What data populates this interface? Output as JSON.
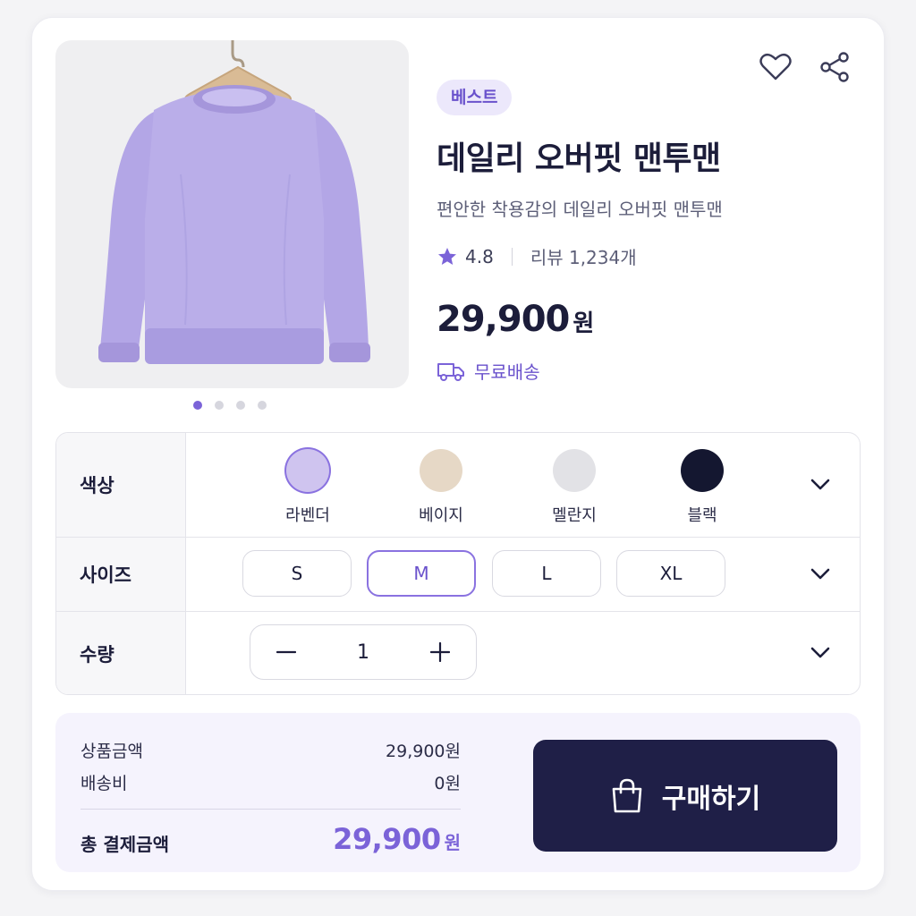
{
  "product": {
    "badge": "베스트",
    "title": "데일리 오버핏 맨투맨",
    "subtitle": "편안한 착용감의 데일리 오버핏 맨투맨",
    "rating": "4.8",
    "reviews": "리뷰 1,234개",
    "price": "29,900",
    "price_unit": "원",
    "shipping": "무료배송",
    "image_icon": "lavender-sweatshirt-on-hanger",
    "image_pages": 4,
    "image_current_page": 1
  },
  "actions": {
    "wishlist_icon": "heart-icon",
    "share_icon": "share-icon"
  },
  "options": {
    "color": {
      "label": "색상",
      "items": [
        {
          "name": "라벤더",
          "hex": "#cfc4ef",
          "selected": true
        },
        {
          "name": "베이지",
          "hex": "#e6d8c6",
          "selected": false
        },
        {
          "name": "멜란지",
          "hex": "#e2e2e6",
          "selected": false
        },
        {
          "name": "블랙",
          "hex": "#141730",
          "selected": false
        }
      ]
    },
    "size": {
      "label": "사이즈",
      "items": [
        {
          "name": "S",
          "selected": false
        },
        {
          "name": "M",
          "selected": true
        },
        {
          "name": "L",
          "selected": false
        },
        {
          "name": "XL",
          "selected": false
        }
      ]
    },
    "quantity": {
      "label": "수량",
      "value": "1",
      "minus": "−",
      "plus": "+"
    }
  },
  "summary": {
    "product_amount_label": "상품금액",
    "product_amount": "29,900원",
    "shipping_fee_label": "배송비",
    "shipping_fee": "0원",
    "total_label": "총 결제금액",
    "total": "29,900",
    "total_unit": "원"
  },
  "buy_button": {
    "label": "구매하기",
    "icon": "shopping-bag-icon"
  },
  "colors": {
    "accent": "#7b63d8",
    "dark": "#1f1f47",
    "badge_bg": "#ece8fb"
  }
}
